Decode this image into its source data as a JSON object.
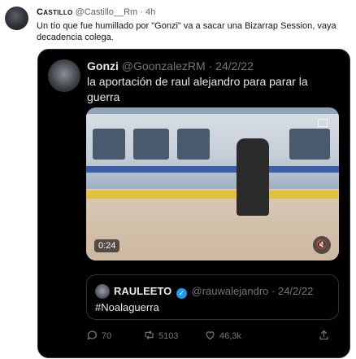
{
  "outer_tweet": {
    "display_name": "Castillo",
    "handle": "@Castillo__Rm",
    "separator": "·",
    "time": "4h",
    "text": "Un tío que fue humillado por \"Gonzi\" va a sacar una Bizarrap Session, vaya decadencia colega."
  },
  "quoted_tweet": {
    "display_name": "Gonzi",
    "handle": "@GoonzalezRM",
    "separator": "·",
    "date": "24/2/22",
    "text": "la aportación de raul alejandro para parar la guerra",
    "video": {
      "duration": "0:24",
      "mute_icon": "speaker-muted-icon",
      "caption_icon": "captions-icon"
    }
  },
  "nested_quote": {
    "display_name": "RAULEETO",
    "verified": "✓",
    "handle": "@rauwalejandro",
    "separator": "·",
    "date": "24/2/22",
    "text": "#Noalaguerra"
  },
  "actions": {
    "reply": {
      "icon": "reply-icon",
      "count": "70"
    },
    "retweet": {
      "icon": "retweet-icon",
      "count": "5103"
    },
    "like": {
      "icon": "heart-icon",
      "count": "46,3k"
    },
    "share": {
      "icon": "share-icon"
    }
  },
  "colors": {
    "dark_bg": "#000000",
    "muted": "#71767b",
    "accent": "#1d9bf0"
  }
}
